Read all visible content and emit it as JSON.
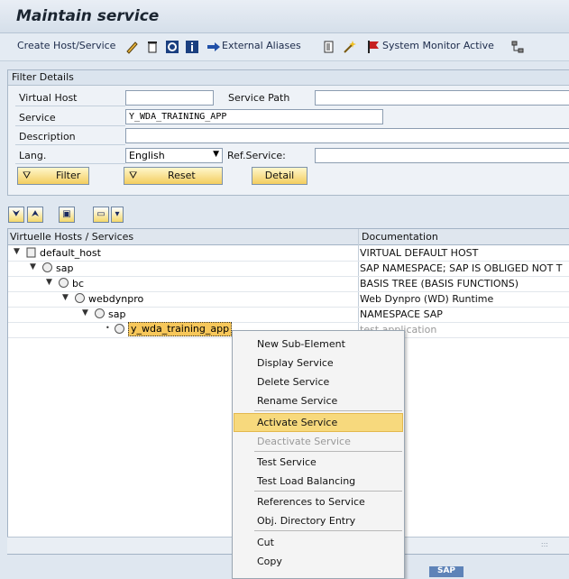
{
  "window": {
    "title": "Maintain service"
  },
  "toolbar": {
    "create": "Create Host/Service",
    "external_aliases": "External Aliases",
    "system_monitor": "System Monitor Active"
  },
  "filter": {
    "header": "Filter Details",
    "virtual_host_label": "Virtual Host",
    "virtual_host_value": "",
    "service_path_label": "Service Path",
    "service_label": "Service",
    "service_value": "Y_WDA_TRAINING_APP",
    "description_label": "Description",
    "lang_label": "Lang.",
    "lang_value": "English",
    "ref_service_label": "Ref.Service:",
    "filter_btn": "Filter",
    "reset_btn": "Reset",
    "detail_btn": "Detail"
  },
  "tree": {
    "col_services": "Virtuelle Hosts / Services",
    "col_doc": "Documentation",
    "rows": [
      {
        "name": "default_host",
        "doc": "VIRTUAL DEFAULT HOST"
      },
      {
        "name": "sap",
        "doc": "SAP NAMESPACE; SAP IS OBLIGED NOT T"
      },
      {
        "name": "bc",
        "doc": "BASIS TREE (BASIS FUNCTIONS)"
      },
      {
        "name": "webdynpro",
        "doc": "Web Dynpro (WD) Runtime"
      },
      {
        "name": "sap",
        "doc": "NAMESPACE SAP"
      },
      {
        "name": "y_wda_training_app",
        "doc": "test application"
      }
    ]
  },
  "context_menu": {
    "items": [
      "New Sub-Element",
      "Display Service",
      "Delete Service",
      "Rename Service",
      "Activate Service",
      "Deactivate Service",
      "Test Service",
      "Test Load Balancing",
      "References to Service",
      "Obj. Directory Entry",
      "Cut",
      "Copy"
    ],
    "highlighted": "Activate Service"
  },
  "footer": {
    "logo": "SAP"
  },
  "colors": {
    "highlight": "#f7d97d",
    "button": "#f3cd5e"
  }
}
